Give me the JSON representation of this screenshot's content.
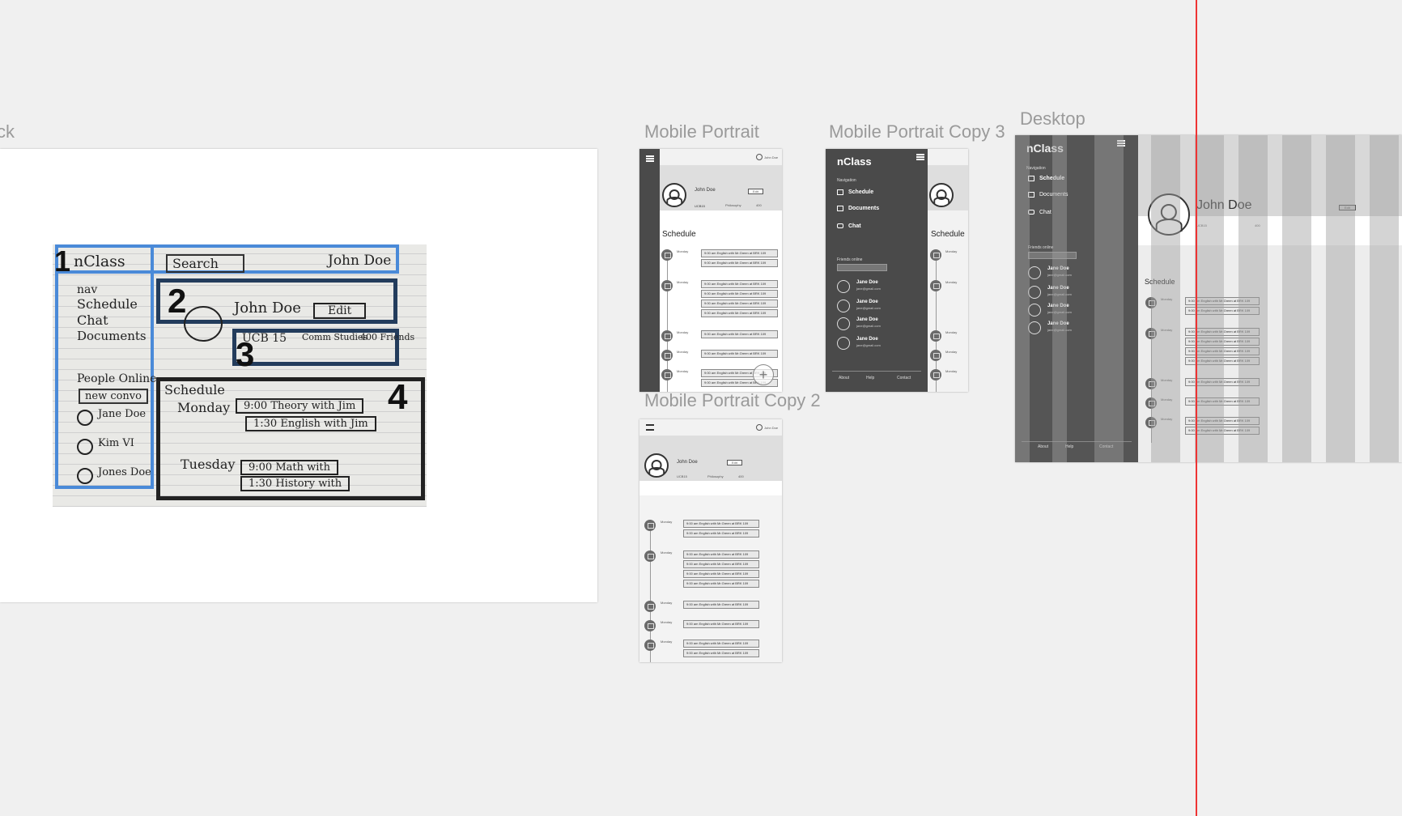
{
  "canvas": {
    "background": "#f0f0f0",
    "guide_color": "#e33"
  },
  "sketch_artboard": {
    "label_fragment": "ck",
    "zones": [
      "1",
      "2",
      "3",
      "4"
    ],
    "sketch_text": {
      "brand": "nClass",
      "search": "Search",
      "user": "John Doe",
      "nav": "nav",
      "nav_items": [
        "Schedule",
        "Chat",
        "Documents"
      ],
      "people_online": "People Online",
      "new_convo": "new convo",
      "people": [
        "Jane Doe",
        "Kim VI",
        "Jones Doe"
      ],
      "profile_name": "John Doe",
      "edit": "Edit",
      "school": "UCB 15",
      "major": "Comm Studies",
      "friends": "400 Friends",
      "schedule": "Schedule",
      "days": [
        "Monday",
        "Tuesday"
      ],
      "monday_events": [
        "9:00 Theory with Jim",
        "1:30 English with Jim"
      ],
      "tuesday_events": [
        "9:00 Math with",
        "1:30 History with"
      ]
    }
  },
  "mobile_portrait": {
    "label": "Mobile Portrait",
    "user_chip": "John Doe",
    "name": "John Doe",
    "edit": "Edit",
    "stats": [
      {
        "value": "UCB15",
        "caption": "University"
      },
      {
        "value": "Philosophy",
        "caption": "Student"
      },
      {
        "value": "400",
        "caption": "Friends"
      }
    ],
    "schedule_title": "Schedule",
    "day": "Monday",
    "date": "Aug 1 2015",
    "event_time": "9:00 am",
    "event_text": "English with Mr.Green at BRK 109"
  },
  "mobile_copy3": {
    "label": "Mobile Portrait Copy 3",
    "brand": "nClass",
    "nav_heading": "Navigation",
    "nav_items": [
      "Schedule",
      "Documents",
      "Chat"
    ],
    "friends_heading": "Friends online",
    "friends": [
      {
        "name": "Jane Doe",
        "email": "jane@gmail.com"
      },
      {
        "name": "Jane Doe",
        "email": "jane@gmail.com"
      },
      {
        "name": "Jane Doe",
        "email": "jane@gmail.com"
      },
      {
        "name": "Jane Doe",
        "email": "jane@gmail.com"
      }
    ],
    "footer": [
      "About",
      "Help",
      "Contact"
    ],
    "schedule_title": "Schedule",
    "day": "Monday",
    "date": "Aug 1 2015"
  },
  "mobile_copy2": {
    "label": "Mobile Portrait Copy 2",
    "user_chip": "John Doe",
    "name": "John Doe",
    "edit": "Edit",
    "stats": [
      {
        "value": "UCB15",
        "caption": "University"
      },
      {
        "value": "Philosophy",
        "caption": "Student"
      },
      {
        "value": "400",
        "caption": "Friends"
      }
    ],
    "day": "Monday",
    "date": "Aug 1 2015",
    "event_time": "9:00 am",
    "event_text": "English with Mr.Green at BRK 109"
  },
  "desktop": {
    "label": "Desktop",
    "brand": "nClass",
    "nav_heading": "Navigation",
    "nav_items": [
      "Schedule",
      "Documents",
      "Chat"
    ],
    "friends_heading": "Friends online",
    "friends": [
      {
        "name": "Jane Doe",
        "email": "jane@gmail.com"
      },
      {
        "name": "Jane Doe",
        "email": "jane@gmail.com"
      },
      {
        "name": "Jane Doe",
        "email": "jane@gmail.com"
      },
      {
        "name": "Jane Doe",
        "email": "jane@gmail.com"
      }
    ],
    "footer": [
      "About",
      "Help",
      "Contact"
    ],
    "name": "John Doe",
    "edit": "Edit",
    "stats": [
      {
        "value": "UCB15",
        "caption": "University"
      },
      {
        "value": "400",
        "caption": "Friends"
      }
    ],
    "schedule_title": "Schedule",
    "day": "Monday",
    "date": "Aug 1 2015",
    "event_time": "9:00 am",
    "event_text": "English with Mr.Green at BRK 109"
  }
}
